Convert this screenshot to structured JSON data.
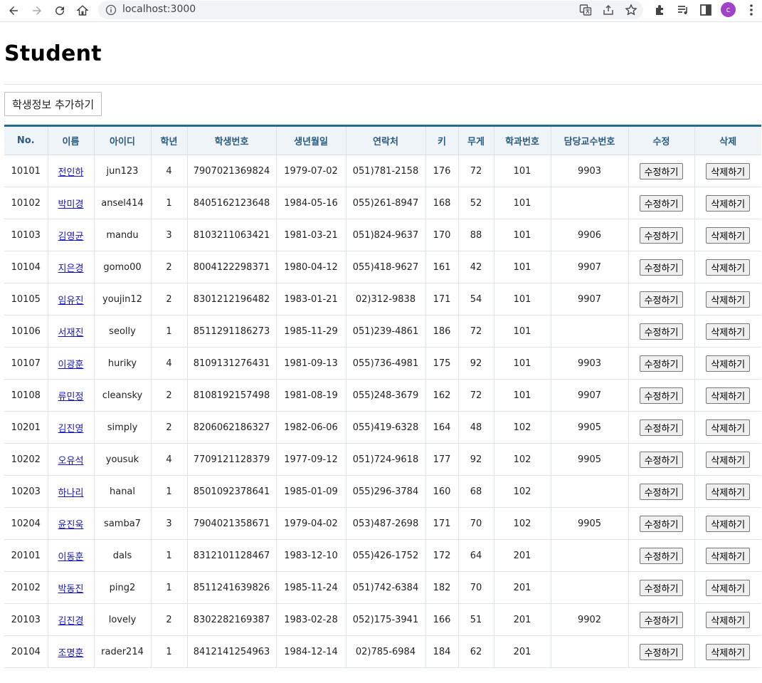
{
  "browser": {
    "url": "localhost:3000",
    "profile_initial": "c",
    "profile_color": "#a142c9"
  },
  "page": {
    "title": "Student",
    "add_button_label": "학생정보 추가하기"
  },
  "table": {
    "columns": [
      "No.",
      "이름",
      "아이디",
      "학년",
      "학생번호",
      "생년월일",
      "연락처",
      "키",
      "무게",
      "학과번호",
      "담당교수번호",
      "수정",
      "삭제"
    ],
    "edit_label": "수정하기",
    "delete_label": "삭제하기",
    "header_color": "#2b5c7d",
    "accent_color": "#256b8e",
    "rows": [
      {
        "no": "10101",
        "name": "전인하",
        "id": "jun123",
        "grade": "4",
        "student_number": "7907021369824",
        "birth": "1979-07-02",
        "phone": "051)781-2158",
        "height": "176",
        "weight": "72",
        "dept": "101",
        "professor": "9903"
      },
      {
        "no": "10102",
        "name": "박미경",
        "id": "ansel414",
        "grade": "1",
        "student_number": "8405162123648",
        "birth": "1984-05-16",
        "phone": "055)261-8947",
        "height": "168",
        "weight": "52",
        "dept": "101",
        "professor": ""
      },
      {
        "no": "10103",
        "name": "김영균",
        "id": "mandu",
        "grade": "3",
        "student_number": "8103211063421",
        "birth": "1981-03-21",
        "phone": "051)824-9637",
        "height": "170",
        "weight": "88",
        "dept": "101",
        "professor": "9906"
      },
      {
        "no": "10104",
        "name": "지은경",
        "id": "gomo00",
        "grade": "2",
        "student_number": "8004122298371",
        "birth": "1980-04-12",
        "phone": "055)418-9627",
        "height": "161",
        "weight": "42",
        "dept": "101",
        "professor": "9907"
      },
      {
        "no": "10105",
        "name": "임유진",
        "id": "youjin12",
        "grade": "2",
        "student_number": "8301212196482",
        "birth": "1983-01-21",
        "phone": "02)312-9838",
        "height": "171",
        "weight": "54",
        "dept": "101",
        "professor": "9907"
      },
      {
        "no": "10106",
        "name": "서재진",
        "id": "seolly",
        "grade": "1",
        "student_number": "8511291186273",
        "birth": "1985-11-29",
        "phone": "051)239-4861",
        "height": "186",
        "weight": "72",
        "dept": "101",
        "professor": ""
      },
      {
        "no": "10107",
        "name": "이광훈",
        "id": "huriky",
        "grade": "4",
        "student_number": "8109131276431",
        "birth": "1981-09-13",
        "phone": "055)736-4981",
        "height": "175",
        "weight": "92",
        "dept": "101",
        "professor": "9903"
      },
      {
        "no": "10108",
        "name": "류민정",
        "id": "cleansky",
        "grade": "2",
        "student_number": "8108192157498",
        "birth": "1981-08-19",
        "phone": "055)248-3679",
        "height": "162",
        "weight": "72",
        "dept": "101",
        "professor": "9907"
      },
      {
        "no": "10201",
        "name": "김진영",
        "id": "simply",
        "grade": "2",
        "student_number": "8206062186327",
        "birth": "1982-06-06",
        "phone": "055)419-6328",
        "height": "164",
        "weight": "48",
        "dept": "102",
        "professor": "9905"
      },
      {
        "no": "10202",
        "name": "오유석",
        "id": "yousuk",
        "grade": "4",
        "student_number": "7709121128379",
        "birth": "1977-09-12",
        "phone": "051)724-9618",
        "height": "177",
        "weight": "92",
        "dept": "102",
        "professor": "9905"
      },
      {
        "no": "10203",
        "name": "하나리",
        "id": "hanal",
        "grade": "1",
        "student_number": "8501092378641",
        "birth": "1985-01-09",
        "phone": "055)296-3784",
        "height": "160",
        "weight": "68",
        "dept": "102",
        "professor": ""
      },
      {
        "no": "10204",
        "name": "윤진욱",
        "id": "samba7",
        "grade": "3",
        "student_number": "7904021358671",
        "birth": "1979-04-02",
        "phone": "053)487-2698",
        "height": "171",
        "weight": "70",
        "dept": "102",
        "professor": "9905"
      },
      {
        "no": "20101",
        "name": "이동훈",
        "id": "dals",
        "grade": "1",
        "student_number": "8312101128467",
        "birth": "1983-12-10",
        "phone": "055)426-1752",
        "height": "172",
        "weight": "64",
        "dept": "201",
        "professor": ""
      },
      {
        "no": "20102",
        "name": "박동진",
        "id": "ping2",
        "grade": "1",
        "student_number": "8511241639826",
        "birth": "1985-11-24",
        "phone": "051)742-6384",
        "height": "182",
        "weight": "70",
        "dept": "201",
        "professor": ""
      },
      {
        "no": "20103",
        "name": "김진경",
        "id": "lovely",
        "grade": "2",
        "student_number": "8302282169387",
        "birth": "1983-02-28",
        "phone": "052)175-3941",
        "height": "166",
        "weight": "51",
        "dept": "201",
        "professor": "9902"
      },
      {
        "no": "20104",
        "name": "조명훈",
        "id": "rader214",
        "grade": "1",
        "student_number": "8412141254963",
        "birth": "1984-12-14",
        "phone": "02)785-6984",
        "height": "184",
        "weight": "62",
        "dept": "201",
        "professor": ""
      }
    ]
  }
}
